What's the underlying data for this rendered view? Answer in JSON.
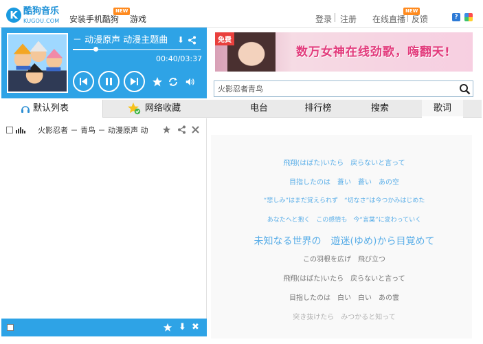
{
  "header": {
    "logo_mark": "K",
    "logo_name": "酷狗音乐",
    "logo_sub": "KUGOU.COM",
    "install_link": "安装手机酷狗",
    "games_link": "游戏",
    "new_badge": "NEW",
    "login": "登录",
    "register": "注册",
    "live": "在线直播",
    "feedback": "反馈",
    "help_glyph": "?"
  },
  "player": {
    "song_title": "－ 动漫原声  动漫主题曲",
    "time": "00:40/03:37",
    "progress": 0.18,
    "art_colors": [
      "#8ad0ff",
      "#f5c89a",
      "#3a3a5a"
    ]
  },
  "ad": {
    "free_label": "免费",
    "text": "数万女神在线劲歌，嗨翻天!"
  },
  "search": {
    "placeholder": "火影忍者青鸟"
  },
  "tabs": {
    "left": [
      {
        "label": "默认列表",
        "icon": "headphones-icon"
      },
      {
        "label": "网络收藏",
        "icon": "star-check-icon"
      }
    ],
    "right": [
      "电台",
      "排行榜",
      "搜索",
      "歌词"
    ],
    "active_right": "歌词"
  },
  "playlist": {
    "items": [
      {
        "title": "火影忍者 － 青鸟 － 动漫原声  动"
      }
    ]
  },
  "lyrics": {
    "lines": [
      {
        "text": "飛翔(はばた)いたら　戻らないと言って",
        "color": "#5aaee8"
      },
      {
        "text": "目指したのは　蒼い　蒼い　あの空",
        "color": "#5aaee8"
      },
      {
        "text": "“悲しみ”はまだ覚えられず　“切なさ”は今つかみはじめた",
        "color": "#5aaee8"
      },
      {
        "text": "あなたへと抱く　この感情も　今“言葉”に変わっていく",
        "color": "#5aaee8"
      },
      {
        "text": "未知なる世界の　遊迷(ゆめ)から目覚めて",
        "color": "#5aaee8"
      },
      {
        "text": "この羽根を広げ　飛び立つ",
        "color": "#777777"
      },
      {
        "text": "飛翔(はばた)いたら　戻らないと言って",
        "color": "#777777"
      },
      {
        "text": "目指したのは　白い　白い　あの雲",
        "color": "#777777"
      },
      {
        "text": "突き抜けたら　みつかると知って",
        "color": "#999999"
      }
    ]
  },
  "colors": {
    "accent": "#2ea3e6",
    "lyric_active": "#5aaee8",
    "ad_text": "#e23b7c"
  }
}
